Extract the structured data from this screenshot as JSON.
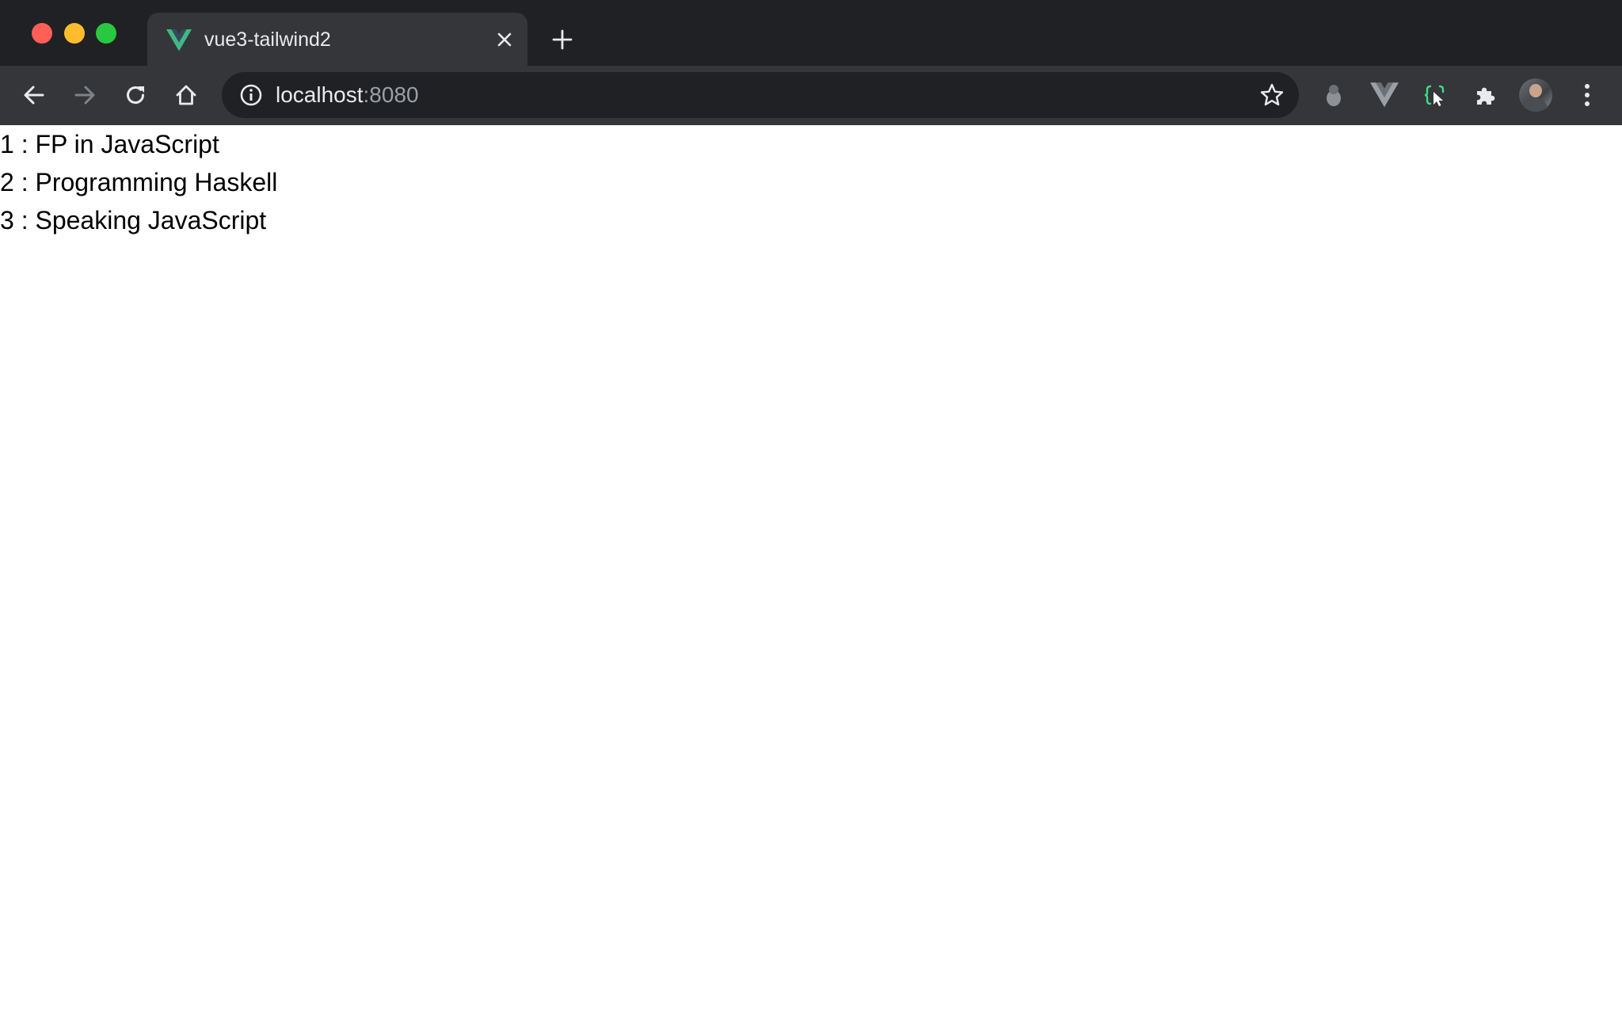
{
  "browser": {
    "tab": {
      "title": "vue3-tailwind2",
      "favicon": "vue-logo-icon"
    },
    "address": {
      "host": "localhost",
      "port": ":8080"
    },
    "icons": {
      "back": "arrow-left-icon",
      "forward": "arrow-right-icon",
      "reload": "reload-icon",
      "home": "home-icon",
      "info": "info-icon",
      "bookmark": "star-icon",
      "extensions": [
        "grey-extension-icon",
        "vue-devtools-icon",
        "selector-extension-icon",
        "puzzle-icon"
      ],
      "menu": "kebab-menu-icon"
    },
    "colors": {
      "frame": "#202124",
      "toolbar": "#35363a",
      "vue_green": "#41b883",
      "vue_dark": "#34495e"
    }
  },
  "books": [
    {
      "id": "1",
      "sep": " : ",
      "title": "FP in JavaScript"
    },
    {
      "id": "2",
      "sep": " : ",
      "title": "Programming Haskell"
    },
    {
      "id": "3",
      "sep": " : ",
      "title": "Speaking JavaScript"
    }
  ]
}
